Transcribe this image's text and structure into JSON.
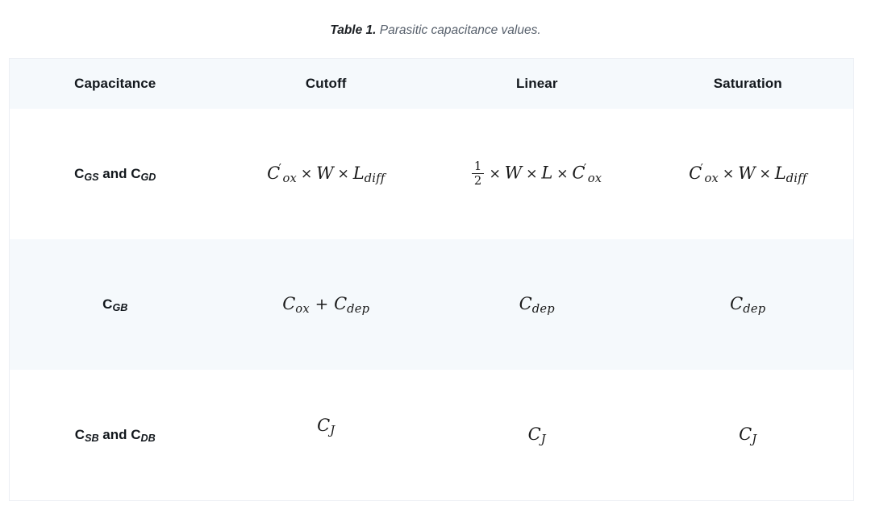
{
  "caption": {
    "label": "Table 1.",
    "text": "Parasitic capacitance values."
  },
  "table": {
    "headers": [
      {
        "id": "capacitance",
        "label": "Capacitance"
      },
      {
        "id": "cutoff",
        "label": "Cutoff"
      },
      {
        "id": "linear",
        "label": "Linear"
      },
      {
        "id": "saturation",
        "label": "Saturation"
      }
    ],
    "rows": [
      {
        "id": "cgs-cgd",
        "label_plain": "C_GS and C_GD",
        "label_parts": {
          "c1": "C",
          "s1": "GS",
          "conj": " and ",
          "c2": "C",
          "s2": "GD"
        },
        "cutoff": "C'_ox × W × L_diff",
        "linear": "1/2 × W × L × C'_ox",
        "saturation": "C'_ox × W × L_diff"
      },
      {
        "id": "cgb",
        "label_plain": "C_GB",
        "label_parts": {
          "c1": "C",
          "s1": "GB"
        },
        "cutoff": "C_ox + C_dep",
        "linear": "C_dep",
        "saturation": "C_dep"
      },
      {
        "id": "csb-cdb",
        "label_plain": "C_SB and C_DB",
        "label_parts": {
          "c1": "C",
          "s1": "SB",
          "conj": " and ",
          "c2": "C",
          "s2": "DB"
        },
        "cutoff": "C_J",
        "linear": "C_J",
        "saturation": "C_J"
      }
    ]
  },
  "symbols": {
    "C": "C",
    "W": "W",
    "L": "L",
    "times": "×",
    "plus": "+",
    "prime": "′",
    "sub_ox": "ox",
    "sub_diff": "diff",
    "sub_dep": "dep",
    "sub_J": "J",
    "sub_GS": "GS",
    "sub_GD": "GD",
    "sub_GB": "GB",
    "sub_SB": "SB",
    "sub_DB": "DB",
    "conj_and": " and ",
    "frac_num_1": "1",
    "frac_den_2": "2"
  },
  "colors": {
    "page_background": "#ffffff",
    "header_fill": "#f5f9fc",
    "stripe_fill": "#f5f9fc",
    "border": "#eceff4",
    "header_text": "#13181d",
    "caption_label": "#1b1f23",
    "caption_text": "#565f6b",
    "math_text": "#1a1a1a"
  }
}
